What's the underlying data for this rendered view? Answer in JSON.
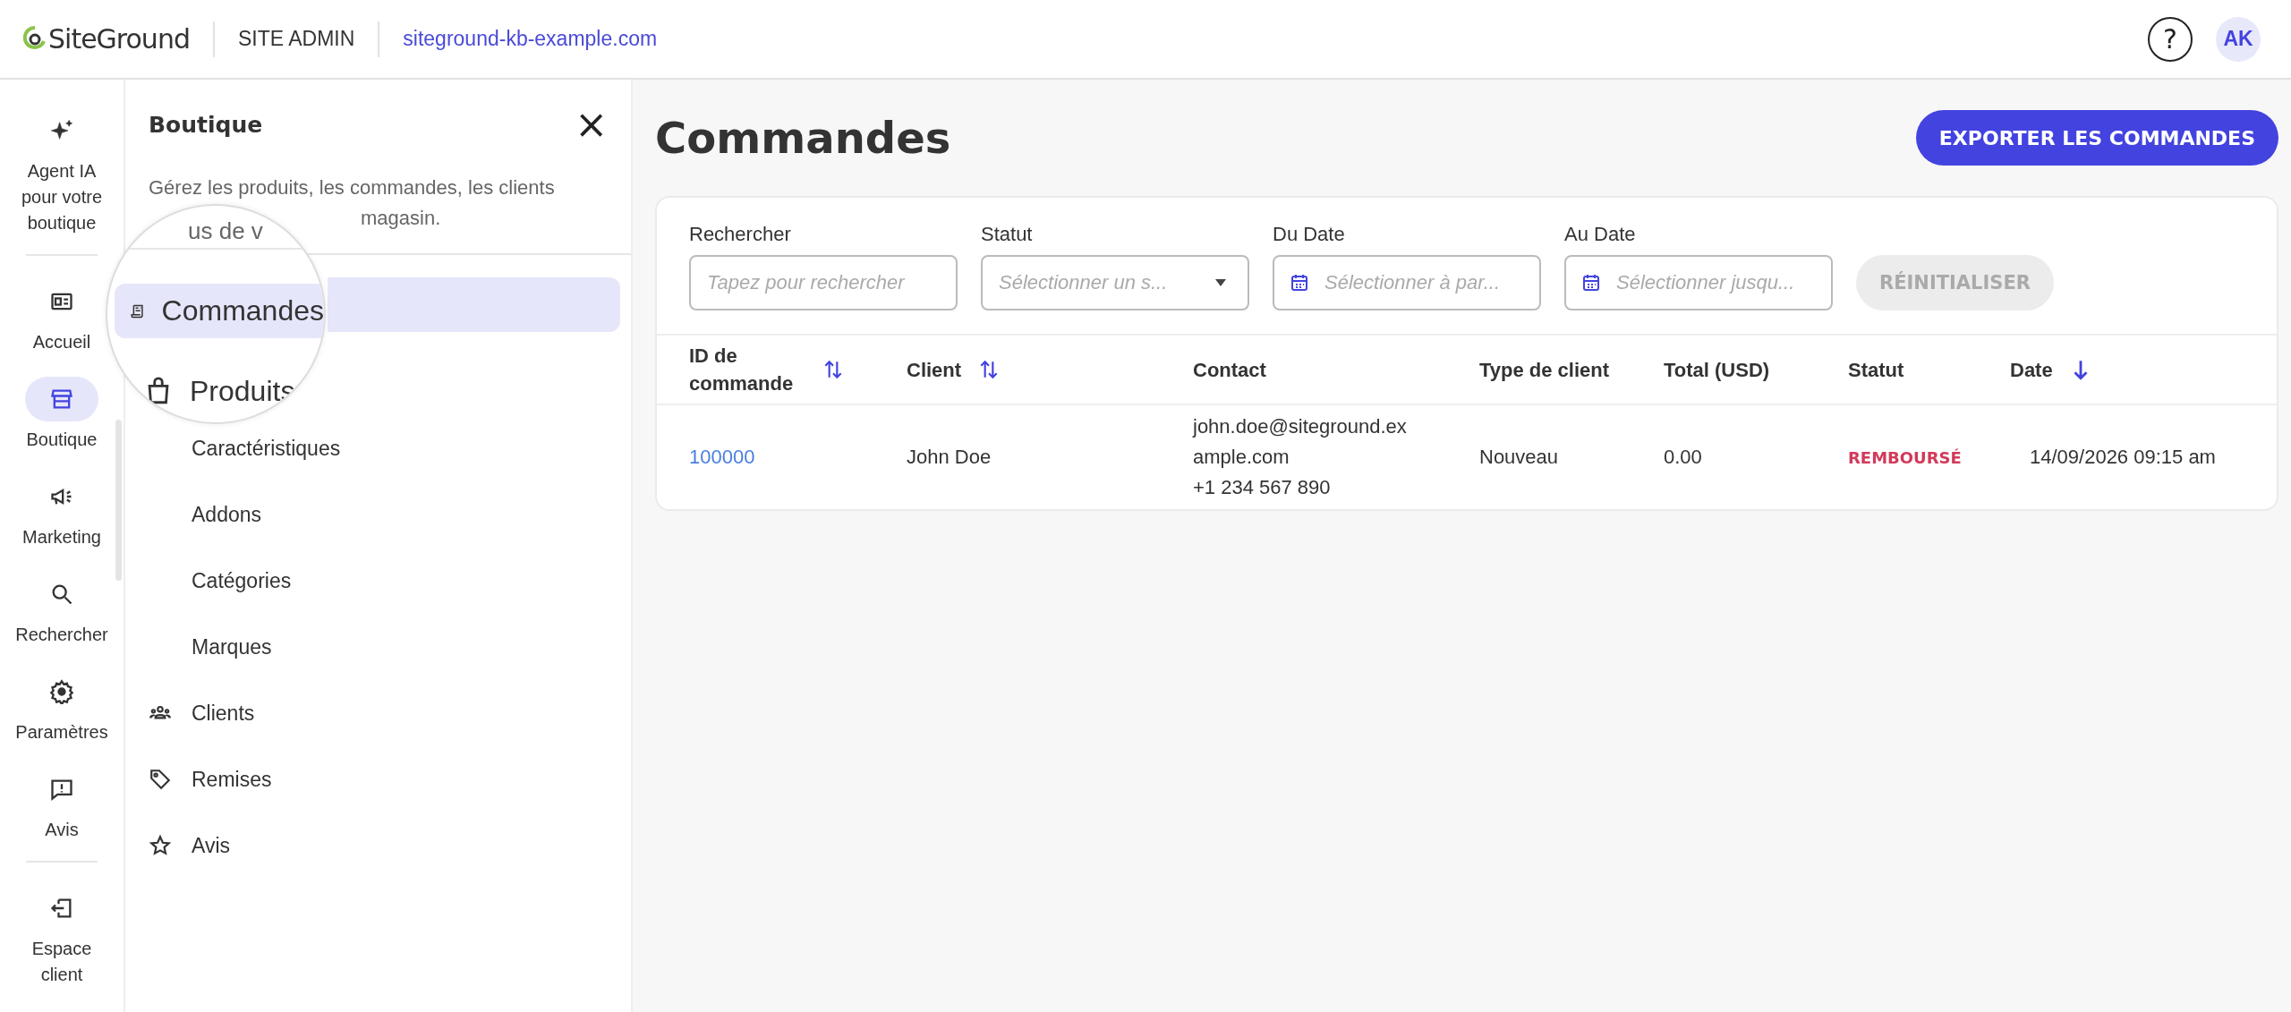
{
  "header": {
    "logo": "SiteGround",
    "section": "SITE ADMIN",
    "site": "siteground-kb-example.com",
    "help": "?",
    "avatar": "AK"
  },
  "rail_groups": [
    [
      {
        "label": "Agent IA pour votre boutique",
        "selected": false
      }
    ],
    [
      {
        "label": "Accueil",
        "selected": false
      },
      {
        "label": "Boutique",
        "selected": true
      },
      {
        "label": "Marketing",
        "selected": false
      },
      {
        "label": "Rechercher",
        "selected": false
      },
      {
        "label": "Paramètres",
        "selected": false
      },
      {
        "label": "Avis",
        "selected": false
      }
    ],
    [
      {
        "label": "Espace client",
        "selected": false
      }
    ]
  ],
  "panel": {
    "title": "Boutique",
    "close": "×",
    "description": "Gérez les produits, les commandes, les clients",
    "description_tail": "magasin.",
    "magnifier": {
      "fragment": "us de v",
      "items": [
        {
          "label": "Commandes",
          "selected": true
        },
        {
          "label": "Produits",
          "selected": false
        }
      ]
    },
    "items": [
      {
        "label": "Caractéristiques"
      },
      {
        "label": "Addons"
      },
      {
        "label": "Catégories"
      },
      {
        "label": "Marques"
      },
      {
        "label": "Clients"
      },
      {
        "label": "Remises"
      },
      {
        "label": "Avis"
      }
    ]
  },
  "page": {
    "title": "Commandes",
    "export": "EXPORTER LES COMMANDES"
  },
  "filters": [
    {
      "label": "Rechercher",
      "placeholder": "Tapez pour rechercher",
      "kind": "text"
    },
    {
      "label": "Statut",
      "placeholder": "Sélectionner un s...",
      "kind": "select"
    },
    {
      "label": "Du Date",
      "placeholder": "Sélectionner à par...",
      "kind": "date"
    },
    {
      "label": "Au Date",
      "placeholder": "Sélectionner jusqu...",
      "kind": "date"
    }
  ],
  "reset": {
    "label": "RÉINITIALISER",
    "disabled": true
  },
  "table": {
    "columns": [
      {
        "label": "ID de commande",
        "sortable": true,
        "sorted": false
      },
      {
        "label": "Client",
        "sortable": true,
        "sorted": false
      },
      {
        "label": "Contact",
        "sortable": false,
        "sorted": false
      },
      {
        "label": "Type de client",
        "sortable": false,
        "sorted": false
      },
      {
        "label": "Total (USD)",
        "sortable": false,
        "sorted": false
      },
      {
        "label": "Statut",
        "sortable": false,
        "sorted": false
      },
      {
        "label": "Date",
        "sortable": true,
        "sorted": true
      }
    ],
    "rows": [
      {
        "id": "100000",
        "client": "John Doe",
        "contact": [
          "john.doe@siteground.ex",
          "ample.com",
          "+1 234 567 890"
        ],
        "type": "Nouveau",
        "total": "0.00",
        "status": "REMBOURSÉ",
        "date": "14/09/2026 09:15 am"
      }
    ]
  }
}
